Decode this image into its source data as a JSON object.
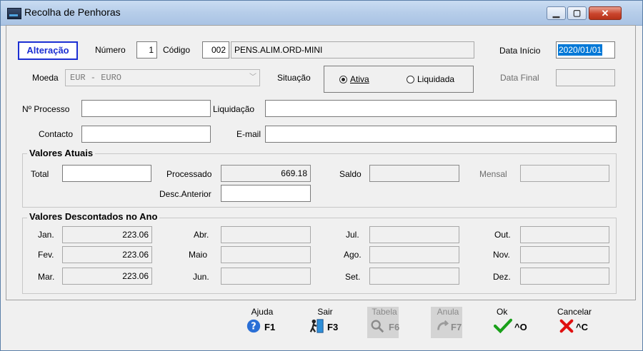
{
  "window": {
    "title": "Recolha de Penhoras",
    "min": "▁",
    "max": "▢",
    "close": "✕"
  },
  "header": {
    "mode": "Alteração",
    "numero_label": "Número",
    "numero": "1",
    "codigo_label": "Código",
    "codigo": "002",
    "descricao": "PENS.ALIM.ORD-MINI",
    "data_inicio_label": "Data Início",
    "data_inicio": "2020/01/01"
  },
  "row2": {
    "moeda_label": "Moeda",
    "moeda": "EUR - EURO",
    "situacao_label": "Situação",
    "ativa": "Ativa",
    "liquidada": "Liquidada",
    "selected": "Ativa",
    "data_final_label": "Data Final",
    "data_final": ""
  },
  "row3": {
    "processo_label": "Nº Processo",
    "processo": "",
    "liquidacao_label": "Liquidação",
    "liquidacao": ""
  },
  "row4": {
    "contacto_label": "Contacto",
    "contacto": "",
    "email_label": "E-mail",
    "email": ""
  },
  "valores_atuais": {
    "title": "Valores Atuais",
    "total_label": "Total",
    "total": "",
    "processado_label": "Processado",
    "processado": "669.18",
    "saldo_label": "Saldo",
    "saldo": "",
    "mensal_label": "Mensal",
    "mensal": "",
    "desc_anterior_label": "Desc.Anterior",
    "desc_anterior": ""
  },
  "valores_ano": {
    "title": "Valores Descontados no Ano",
    "months": [
      {
        "label": "Jan.",
        "value": "223.06"
      },
      {
        "label": "Fev.",
        "value": "223.06"
      },
      {
        "label": "Mar.",
        "value": "223.06"
      },
      {
        "label": "Abr.",
        "value": ""
      },
      {
        "label": "Maio",
        "value": ""
      },
      {
        "label": "Jun.",
        "value": ""
      },
      {
        "label": "Jul.",
        "value": ""
      },
      {
        "label": "Ago.",
        "value": ""
      },
      {
        "label": "Set.",
        "value": ""
      },
      {
        "label": "Out.",
        "value": ""
      },
      {
        "label": "Nov.",
        "value": ""
      },
      {
        "label": "Dez.",
        "value": ""
      }
    ]
  },
  "toolbar": {
    "ajuda": {
      "label": "Ajuda",
      "key": "F1"
    },
    "sair": {
      "label": "Sair",
      "key": "F3"
    },
    "tabela": {
      "label": "Tabela",
      "key": "F6"
    },
    "anula": {
      "label": "Anula",
      "key": "F7"
    },
    "ok": {
      "label": "Ok",
      "key": "^O"
    },
    "cancelar": {
      "label": "Cancelar",
      "key": "^C"
    }
  },
  "colors": {
    "accent": "#1c2fd3",
    "selection": "#0078d7",
    "ok": "#1aa01a",
    "cancel": "#e01010",
    "help": "#2a6fd6"
  }
}
